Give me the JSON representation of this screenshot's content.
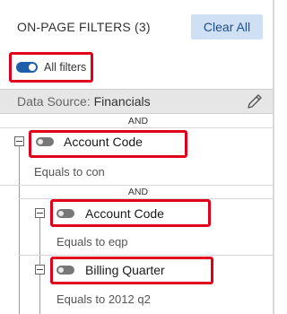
{
  "header": {
    "title": "ON-PAGE FILTERS (3)",
    "clear_all_label": "Clear All"
  },
  "all_filters": {
    "label": "All filters",
    "enabled": true
  },
  "data_source": {
    "prefix": "Data Source: ",
    "name": "Financials"
  },
  "groups": {
    "top_operator": "AND",
    "filter1": {
      "name": "Account Code",
      "condition": "Equals to con",
      "enabled": false
    },
    "nested_operator": "AND",
    "filter2": {
      "name": "Account Code",
      "condition": "Equals to eqp",
      "enabled": false
    },
    "filter3": {
      "name": "Billing Quarter",
      "condition": "Equals to 2012 q2",
      "enabled": false
    }
  },
  "colors": {
    "accent": "#1f5fa9",
    "clear_button_bg": "#cfe0f5",
    "highlight": "#e0001b"
  }
}
